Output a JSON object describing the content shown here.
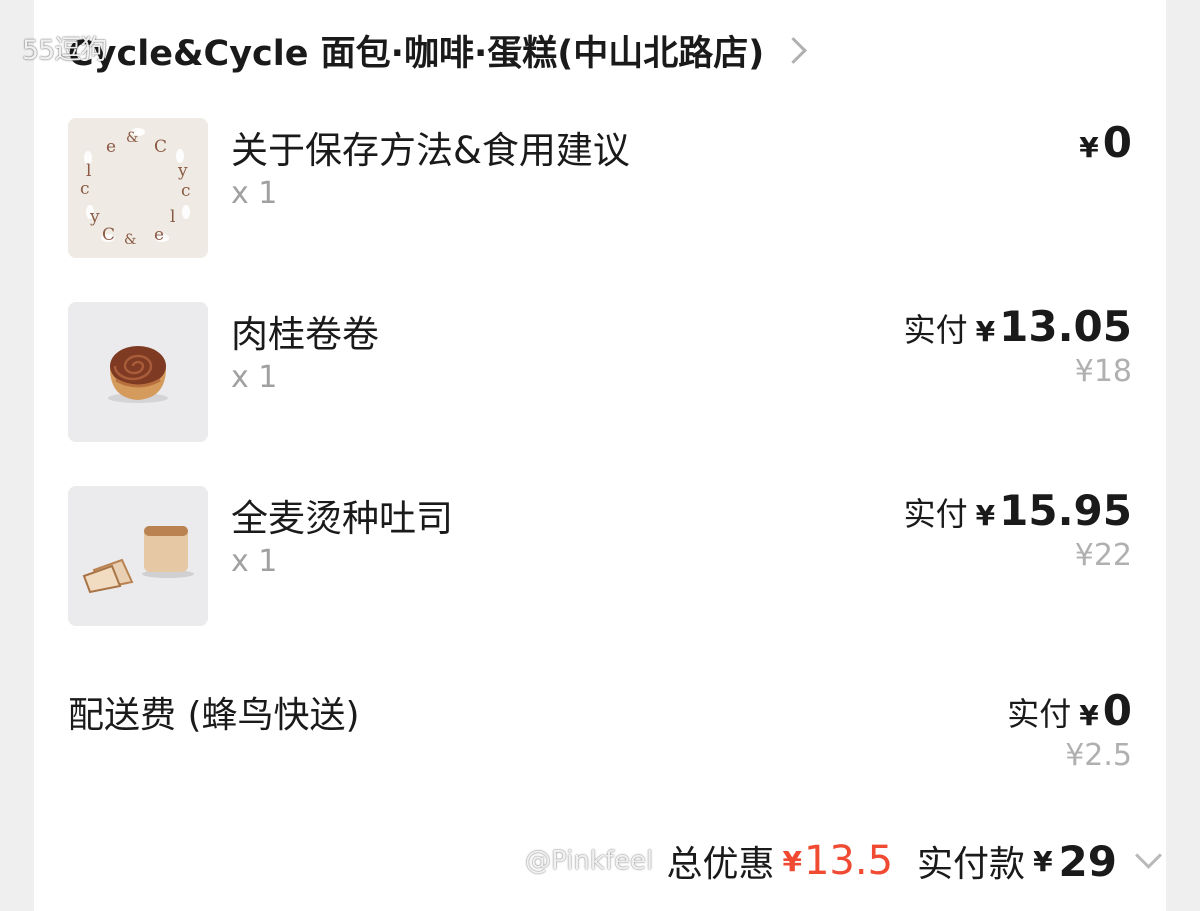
{
  "watermarks": {
    "top": "55逗狗",
    "bottom": "@Pinkfeel"
  },
  "store": {
    "name": "Cycle&Cycle 面包·咖啡·蛋糕(中山北路店)"
  },
  "items": [
    {
      "name": "关于保存方法&食用建议",
      "qty": "x 1",
      "paid_label": "",
      "currency": "¥",
      "price": "0",
      "original_price": "",
      "thumbnail": "brand-logo",
      "logo_text": "Cycle&Cycle"
    },
    {
      "name": "肉桂卷卷",
      "qty": "x 1",
      "paid_label": "实付",
      "currency": "¥",
      "price": "13.05",
      "original_price": "¥18",
      "thumbnail": "cinnamon-roll"
    },
    {
      "name": "全麦烫种吐司",
      "qty": "x 1",
      "paid_label": "实付",
      "currency": "¥",
      "price": "15.95",
      "original_price": "¥22",
      "thumbnail": "toast-bread"
    }
  ],
  "delivery": {
    "label": "配送费 (蜂鸟快送)",
    "paid_label": "实付",
    "currency": "¥",
    "price": "0",
    "original_price": "¥2.5"
  },
  "summary": {
    "discount_label": "总优惠",
    "discount_currency": "¥",
    "discount_value": "13.5",
    "total_label": "实付款",
    "total_currency": "¥",
    "total_value": "29"
  },
  "colors": {
    "discount_red": "#f04a32",
    "muted_gray": "#a0a0a0",
    "text": "#1a1a1a"
  }
}
